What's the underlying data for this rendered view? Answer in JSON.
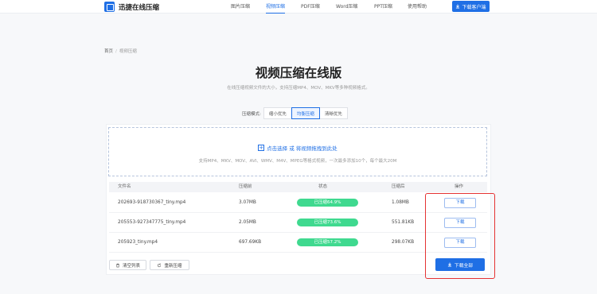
{
  "brand": {
    "name": "迅捷在线压缩"
  },
  "nav": {
    "items": [
      "图片压缩",
      "视频压缩",
      "PDF压缩",
      "Word压缩",
      "PPT压缩",
      "使用帮助"
    ],
    "active": "视频压缩",
    "download_client": "下载客户端"
  },
  "breadcrumb": {
    "home": "首页",
    "separator": "/",
    "current": "视频压缩"
  },
  "page": {
    "title": "视频压缩在线版",
    "subtitle": "在线压缩视频文件的大小，支持压缩MP4、MOV、MKV等多种视频格式。"
  },
  "mode": {
    "label": "压缩模式:",
    "options": [
      "缩小优先",
      "均衡压缩",
      "清晰优先"
    ],
    "selected": "均衡压缩"
  },
  "dropzone": {
    "main_text": "点击选择 或 将视频拖拽到此处",
    "sub_text": "支持MP4、MKV、MOV、AVI、WMV、M4V、MPEG等格式视频，一次最多添加10个，每个最大20M"
  },
  "table": {
    "headers": {
      "filename": "文件名",
      "before": "压缩前",
      "status": "状态",
      "after": "压缩后",
      "action": "操作"
    },
    "rows": [
      {
        "filename": "202693-918730367_tiny.mp4",
        "before": "3.07MB",
        "status": "已压缩64.9%",
        "after": "1.08MB",
        "action": "下载"
      },
      {
        "filename": "205553-927347775_tiny.mp4",
        "before": "2.05MB",
        "status": "已压缩73.6%",
        "after": "551.81KB",
        "action": "下载"
      },
      {
        "filename": "205923_tiny.mp4",
        "before": "697.69KB",
        "status": "已压缩57.2%",
        "after": "298.07KB",
        "action": "下载"
      }
    ]
  },
  "actions": {
    "clear": "清空列表",
    "recompress": "重新压缩",
    "download_all": "下载全部"
  },
  "colors": {
    "accent": "#1f6fe5",
    "status_pill": "#3fd98f",
    "highlight_box": "#e53333"
  }
}
